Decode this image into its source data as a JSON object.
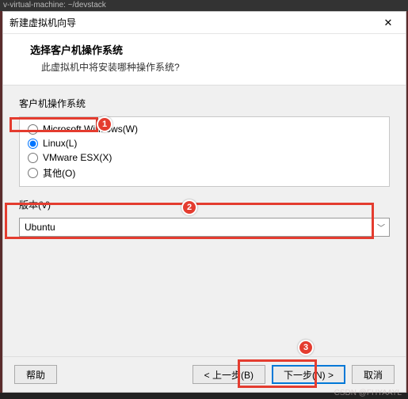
{
  "bg_top_text": "v-virtual-machine: ~/devstack",
  "titlebar": {
    "title": "新建虚拟机向导",
    "close": "✕"
  },
  "header": {
    "title": "选择客户机操作系统",
    "subtitle": "此虚拟机中将安装哪种操作系统?"
  },
  "group_os_label": "客户机操作系统",
  "radios": [
    {
      "label": "Microsoft Windows(W)"
    },
    {
      "label": "Linux(L)"
    },
    {
      "label": "VMware ESX(X)"
    },
    {
      "label": "其他(O)"
    }
  ],
  "version_label": "版本(V)",
  "version_selected": "Ubuntu",
  "buttons": {
    "help": "帮助",
    "back": "< 上一步(B)",
    "next": "下一步(N) >",
    "cancel": "取消"
  },
  "annotations": {
    "a1": "1",
    "a2": "2",
    "a3": "3"
  },
  "watermark": "CSDN @FHYAAYL"
}
